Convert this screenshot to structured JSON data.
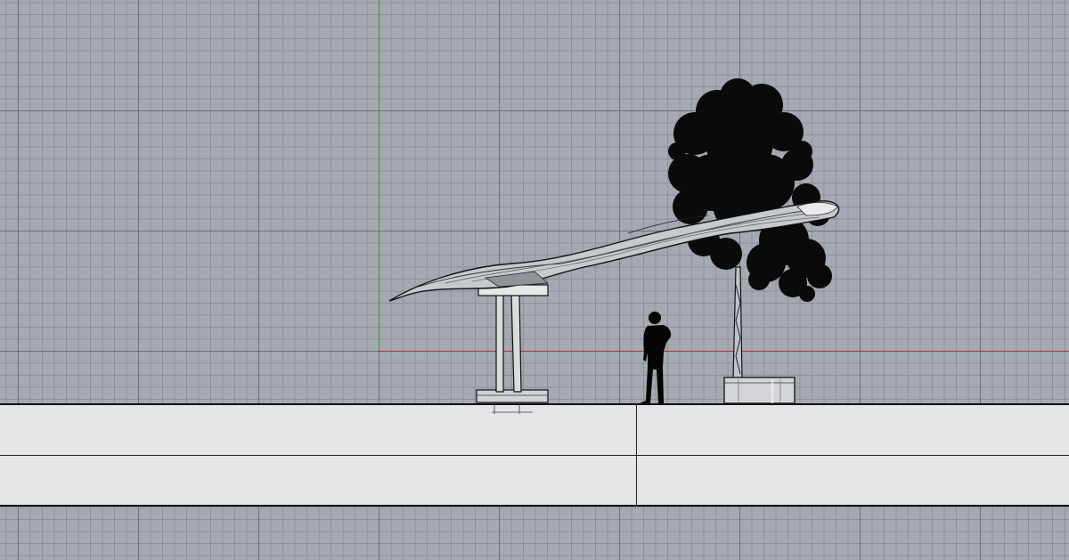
{
  "viewport": {
    "background": "#a4a9b2",
    "axis_x_color": "#b03434",
    "axis_y_color": "#2aa02a",
    "ground_color": "#e4e5e7"
  },
  "objects": [
    {
      "id": "canopy",
      "icon": "canopy-surface"
    },
    {
      "id": "column",
      "icon": "canopy-column"
    },
    {
      "id": "person",
      "icon": "human-silhouette"
    },
    {
      "id": "tree",
      "icon": "tree-silhouette"
    },
    {
      "id": "planter",
      "icon": "planter-cylinder"
    }
  ]
}
